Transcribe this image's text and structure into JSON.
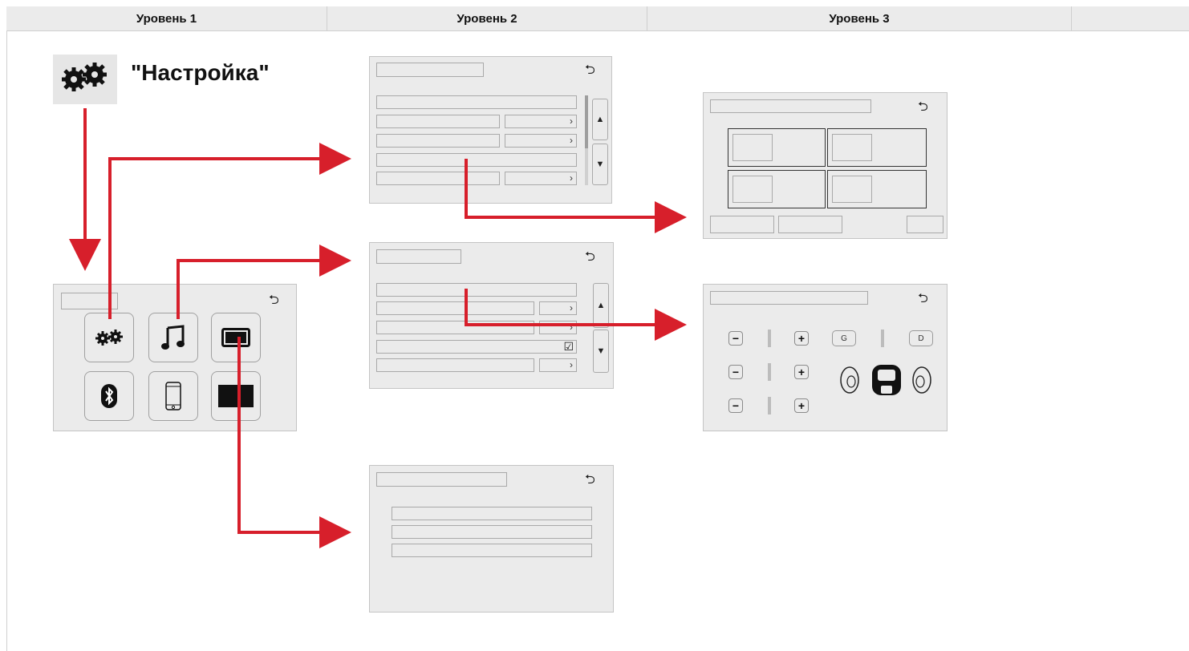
{
  "header": {
    "columns": [
      "Уровень 1",
      "Уровень 2",
      "Уровень 3"
    ]
  },
  "settings_title": "\"Настройка\"",
  "icons": {
    "settings": "gears-icon",
    "music": "music-note-icon",
    "display": "display-icon",
    "bluetooth": "bluetooth-icon",
    "phone": "phone-icon",
    "black_screen": "black-screen-icon",
    "back": "return-arrow-icon"
  },
  "glyphs": {
    "back": "⮌",
    "chevron": "›",
    "scroll_up": "▲",
    "scroll_down": "▼",
    "checkbox": "☑",
    "bluetooth": "ᛒ",
    "minus": "−",
    "plus": "+",
    "music": "♫"
  },
  "balance": {
    "left_label": "G",
    "right_label": "D"
  },
  "colors": {
    "arrow": "#d71f2b",
    "panel_bg": "#ebebeb",
    "header_bg": "#ebebeb"
  }
}
